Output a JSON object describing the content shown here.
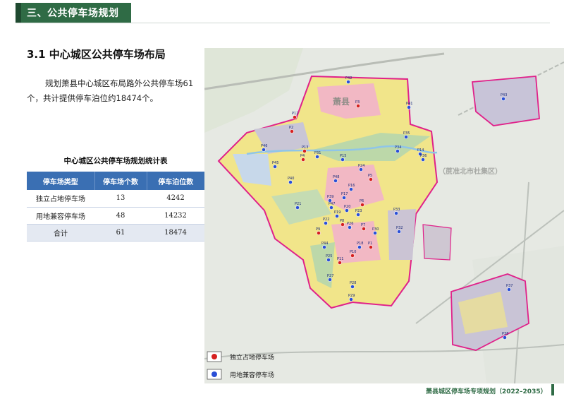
{
  "header": {
    "title": "三、公共停车场规划"
  },
  "section": {
    "heading": "3.1 中心城区公共停车场布局",
    "paragraph": "规划萧县中心城区布局路外公共停车场61个，共计提供停车泊位约18474个。"
  },
  "table": {
    "title": "中心城区公共停车场规划统计表",
    "headers": [
      "停车场类型",
      "停车场个数",
      "停车泊位数"
    ],
    "rows": [
      {
        "type": "独立占地停车场",
        "count": "13",
        "spaces": "4242"
      },
      {
        "type": "用地兼容停车场",
        "count": "48",
        "spaces": "14232"
      },
      {
        "type": "合计",
        "count": "61",
        "spaces": "18474"
      }
    ]
  },
  "map": {
    "district_label": "（蔗准北市杜集区）",
    "city_label": "萧县",
    "legend": [
      {
        "label": "独立占地停车场",
        "color": "#d62020"
      },
      {
        "label": "用地兼容停车场",
        "color": "#2a4fd6"
      }
    ],
    "markers": [
      {
        "id": "P1",
        "type": "independent"
      },
      {
        "id": "P2",
        "type": "independent"
      },
      {
        "id": "P3",
        "type": "independent"
      },
      {
        "id": "P4",
        "type": "independent"
      },
      {
        "id": "P5",
        "type": "independent"
      },
      {
        "id": "P6",
        "type": "independent"
      },
      {
        "id": "P7",
        "type": "independent"
      },
      {
        "id": "P8",
        "type": "independent"
      },
      {
        "id": "P9",
        "type": "independent"
      },
      {
        "id": "P10",
        "type": "independent"
      },
      {
        "id": "P11",
        "type": "independent"
      },
      {
        "id": "P12",
        "type": "independent"
      },
      {
        "id": "P13",
        "type": "independent"
      },
      {
        "id": "P14",
        "type": "compatible"
      },
      {
        "id": "P15",
        "type": "compatible"
      },
      {
        "id": "P16",
        "type": "compatible"
      },
      {
        "id": "P17",
        "type": "compatible"
      },
      {
        "id": "P18",
        "type": "compatible"
      },
      {
        "id": "P19",
        "type": "compatible"
      },
      {
        "id": "P20",
        "type": "compatible"
      },
      {
        "id": "P21",
        "type": "compatible"
      },
      {
        "id": "P22",
        "type": "compatible"
      },
      {
        "id": "P23",
        "type": "compatible"
      },
      {
        "id": "P24",
        "type": "compatible"
      },
      {
        "id": "P25",
        "type": "compatible"
      },
      {
        "id": "P26",
        "type": "compatible"
      },
      {
        "id": "P27",
        "type": "compatible"
      },
      {
        "id": "P28",
        "type": "compatible"
      },
      {
        "id": "P29",
        "type": "compatible"
      },
      {
        "id": "P30",
        "type": "compatible"
      },
      {
        "id": "P31",
        "type": "compatible"
      },
      {
        "id": "P32",
        "type": "compatible"
      },
      {
        "id": "P33",
        "type": "compatible"
      },
      {
        "id": "P34",
        "type": "compatible"
      },
      {
        "id": "P35",
        "type": "compatible"
      },
      {
        "id": "P36",
        "type": "compatible"
      },
      {
        "id": "P37",
        "type": "compatible"
      },
      {
        "id": "P38",
        "type": "compatible"
      },
      {
        "id": "P39",
        "type": "compatible"
      },
      {
        "id": "P40",
        "type": "compatible"
      },
      {
        "id": "P41",
        "type": "compatible"
      },
      {
        "id": "P42",
        "type": "compatible"
      },
      {
        "id": "P43",
        "type": "compatible"
      },
      {
        "id": "P44",
        "type": "compatible"
      },
      {
        "id": "P45",
        "type": "compatible"
      },
      {
        "id": "P46",
        "type": "compatible"
      },
      {
        "id": "P47",
        "type": "compatible"
      },
      {
        "id": "P48",
        "type": "compatible"
      }
    ]
  },
  "footer": {
    "text": "萧县城区停车场专项规划（2022–2035）"
  }
}
